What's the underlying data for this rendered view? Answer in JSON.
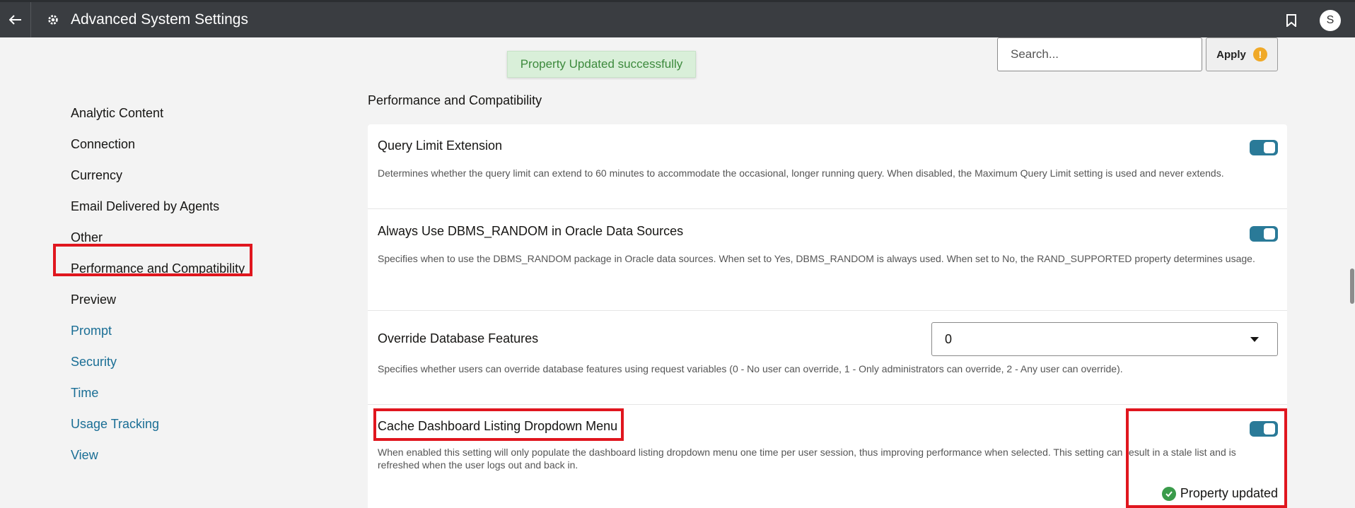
{
  "header": {
    "title": "Advanced System Settings",
    "avatar_initial": "S",
    "back_icon": "arrow-left-icon",
    "settings_icon": "gear-icon",
    "bookmark_icon": "bookmark-icon"
  },
  "toast": {
    "message": "Property Updated successfully",
    "color": "#3d8a3d"
  },
  "search": {
    "placeholder": "Search..."
  },
  "apply": {
    "label": "Apply",
    "icon": "warning-icon"
  },
  "sidebar": {
    "items": [
      {
        "label": "Analytic Content"
      },
      {
        "label": "Connection"
      },
      {
        "label": "Currency"
      },
      {
        "label": "Email Delivered by Agents"
      },
      {
        "label": "Other"
      },
      {
        "label": "Performance and Compatibility"
      },
      {
        "label": "Preview"
      },
      {
        "label": "Prompt"
      },
      {
        "label": "Security"
      },
      {
        "label": "Time"
      },
      {
        "label": "Usage Tracking"
      },
      {
        "label": "View"
      }
    ]
  },
  "main": {
    "section_title": "Performance and Compatibility",
    "settings": [
      {
        "title": "Query Limit Extension",
        "description": "Determines whether the query limit can extend to 60 minutes to accommodate the occasional, longer running query. When disabled, the Maximum Query Limit setting is used and never extends.",
        "control": "toggle",
        "enabled": true
      },
      {
        "title": "Always Use DBMS_RANDOM in Oracle Data Sources",
        "description": "Specifies when to use the DBMS_RANDOM package in Oracle data sources. When set to Yes, DBMS_RANDOM is always used. When set to No, the RAND_SUPPORTED property determines usage.",
        "control": "toggle",
        "enabled": true
      },
      {
        "title": "Override Database Features",
        "description": "Specifies whether users can override database features using request variables (0 - No user can override, 1 - Only administrators can override, 2 - Any user can override).",
        "control": "select",
        "value": "0"
      },
      {
        "title": "Cache Dashboard Listing Dropdown Menu",
        "description": "When enabled this setting will only populate the dashboard listing dropdown menu one time per user session, thus improving performance when selected. This setting can result in a stale list and is refreshed when the user logs out and back in.",
        "control": "toggle",
        "enabled": true,
        "status": "Property updated"
      }
    ]
  },
  "colors": {
    "accent": "#2a7a98",
    "link": "#1a6e95",
    "highlight": "#e0161e"
  }
}
